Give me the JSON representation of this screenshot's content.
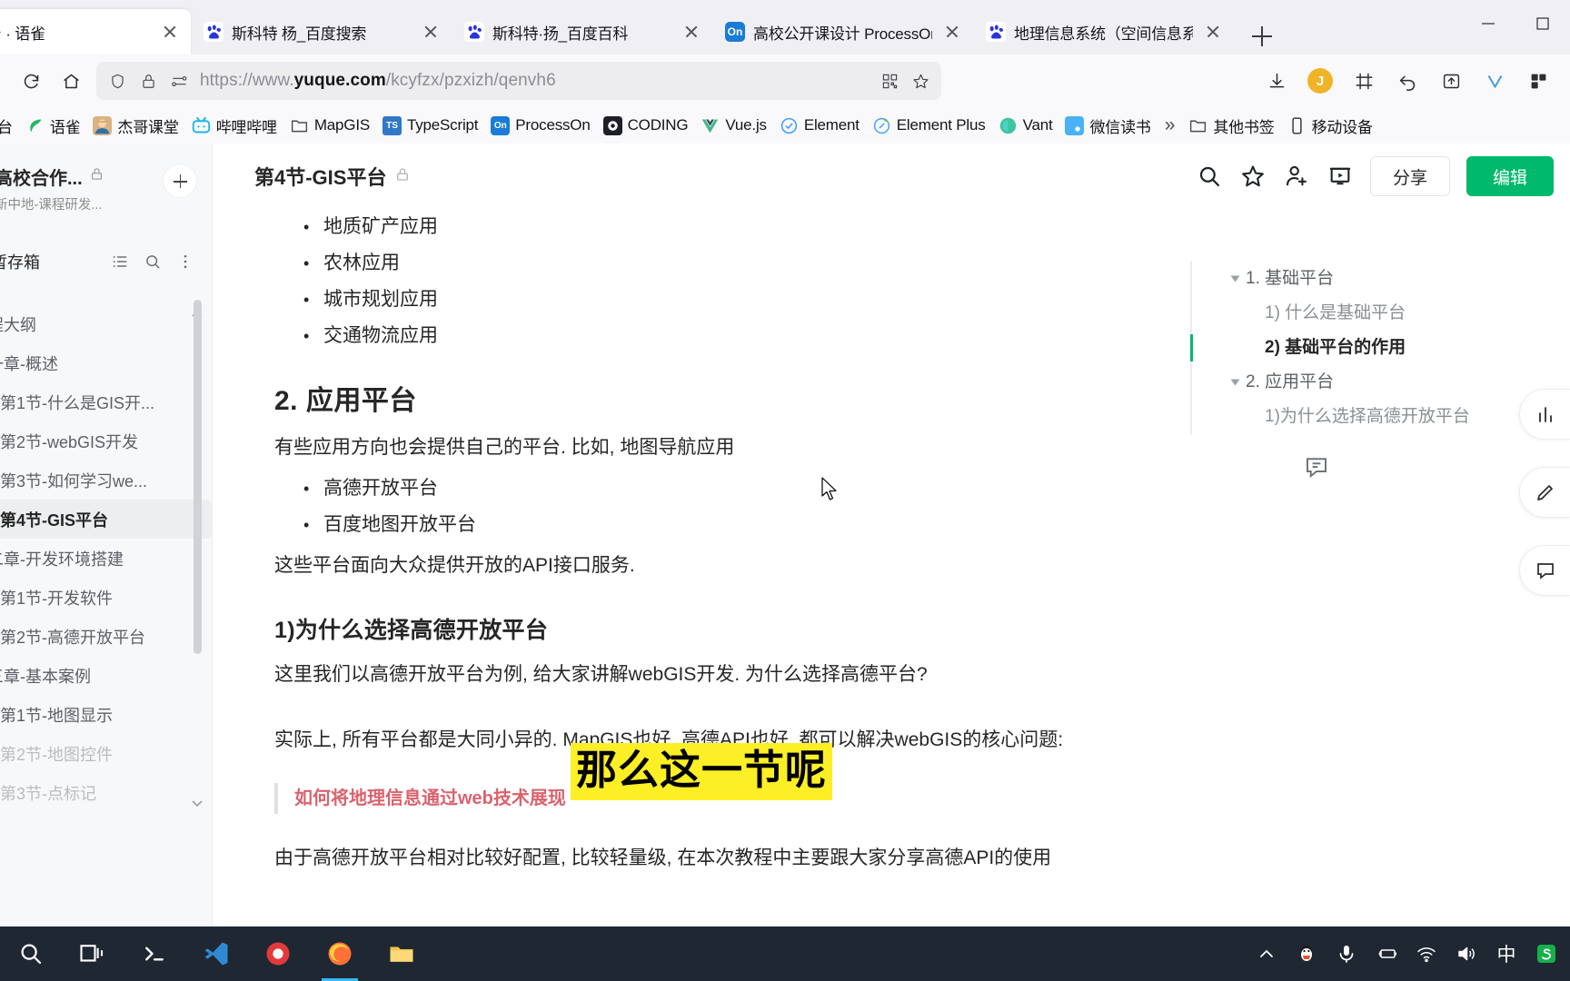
{
  "browser": {
    "tabs": [
      {
        "title": "-GIS平台 · 语雀",
        "favicon": "yuque-icon",
        "active": true
      },
      {
        "title": "斯科特 杨_百度搜索",
        "favicon": "baidu-icon",
        "active": false
      },
      {
        "title": "斯科特·扬_百度百科",
        "favicon": "baidu-icon",
        "active": false
      },
      {
        "title": "高校公开课设计 ProcessOn",
        "favicon": "processon-icon",
        "active": false
      },
      {
        "title": "地理信息系统（空间信息系统",
        "favicon": "baidu-icon",
        "active": false
      }
    ],
    "new_tab_label": "+",
    "window_controls": [
      "minimize",
      "maximize",
      "close"
    ],
    "url": {
      "prefix": "https://www.",
      "domain": "yuque.com",
      "path": "/kcyfzx/pzxizh/qenvh6"
    },
    "nav_icons": [
      "reload-icon",
      "home-icon"
    ],
    "urlbar_icons": [
      "shield-icon",
      "lock-icon",
      "permissions-icon"
    ],
    "urlbar_right_icons": [
      "qrcode-icon",
      "star-icon"
    ],
    "toolbar_right_icons": [
      "download-icon",
      "account-avatar",
      "screenshot-icon",
      "undo-icon",
      "save-page-icon",
      "vimium-icon",
      "extensions-icon"
    ],
    "account_initial": "J",
    "bookmarks": [
      {
        "label": "台",
        "icon": "partial-icon"
      },
      {
        "label": "语雀",
        "icon": "yuque-icon"
      },
      {
        "label": "杰哥课堂",
        "icon": "avatar-icon"
      },
      {
        "label": "哔哩哔哩",
        "icon": "bilibili-icon"
      },
      {
        "label": "MapGIS",
        "icon": "folder-icon"
      },
      {
        "label": "TypeScript",
        "icon": "ts-icon"
      },
      {
        "label": "ProcessOn",
        "icon": "processon-icon"
      },
      {
        "label": "CODING",
        "icon": "coding-icon"
      },
      {
        "label": "Vue.js",
        "icon": "vue-icon"
      },
      {
        "label": "Element",
        "icon": "element-icon"
      },
      {
        "label": "Element Plus",
        "icon": "element-plus-icon"
      },
      {
        "label": "Vant",
        "icon": "vant-icon"
      },
      {
        "label": "微信读书",
        "icon": "wechat-read-icon"
      }
    ],
    "bookmarks_overflow": "»",
    "other_bookmarks": "其他书签",
    "mobile_bookmarks": "移动设备"
  },
  "app": {
    "sidebar": {
      "book_title": "高校合作...",
      "book_lock_icon": "lock-icon",
      "book_subtitle": "新中地-课程研发...",
      "add_button": "+",
      "drafts_label": "暂存箱",
      "drafts_icons": [
        "list-icon",
        "search-icon",
        "more-icon"
      ],
      "items": [
        {
          "label": "程大纲",
          "level": 0,
          "state": "normal"
        },
        {
          "label": "一章-概述",
          "level": 0,
          "state": "normal"
        },
        {
          "label": "第1节-什么是GIS开...",
          "level": 1,
          "state": "normal"
        },
        {
          "label": "第2节-webGIS开发",
          "level": 1,
          "state": "normal"
        },
        {
          "label": "第3节-如何学习we...",
          "level": 1,
          "state": "normal"
        },
        {
          "label": "第4节-GIS平台",
          "level": 1,
          "state": "active"
        },
        {
          "label": "二章-开发环境搭建",
          "level": 0,
          "state": "normal"
        },
        {
          "label": "第1节-开发软件",
          "level": 1,
          "state": "normal"
        },
        {
          "label": "第2节-高德开放平台",
          "level": 1,
          "state": "normal"
        },
        {
          "label": "三章-基本案例",
          "level": 0,
          "state": "normal"
        },
        {
          "label": "第1节-地图显示",
          "level": 1,
          "state": "normal"
        },
        {
          "label": "第2节-地图控件",
          "level": 1,
          "state": "dim"
        },
        {
          "label": "第3节-点标记",
          "level": 1,
          "state": "dim"
        }
      ]
    },
    "topbar": {
      "doc_title": "第4节-GIS平台",
      "lock_icon": "lock-icon",
      "icons": [
        "search-icon",
        "star-icon",
        "add-person-icon",
        "presentation-icon"
      ],
      "share_label": "分享",
      "edit_label": "编辑"
    },
    "document": {
      "bullets_top": [
        "地质矿产应用",
        "农林应用",
        "城市规划应用",
        "交通物流应用"
      ],
      "h2": "2. 应用平台",
      "para1": "有些应用方向也会提供自己的平台. 比如, 地图导航应用",
      "bullets_mid": [
        "高德开放平台",
        "百度地图开放平台"
      ],
      "para2": "这些平台面向大众提供开放的API接口服务.",
      "h3": "1)为什么选择高德开放平台",
      "para3": "这里我们以高德开放平台为例, 给大家讲解webGIS开发. 为什么选择高德平台?",
      "para4": "实际上, 所有平台都是大同小异的. MapGIS也好, 高德API也好, 都可以解决webGIS的核心问题:",
      "quote": "如何将地理信息通过web技术展现",
      "para5": "由于高德开放平台相对比较好配置, 比较轻量级, 在本次教程中主要跟大家分享高德API的使用",
      "overlay_caption": "那么这一节呢",
      "overlay_bg_color": "#fcef25",
      "comment_icon": "comment-icon"
    },
    "toc": [
      {
        "label": "1. 基础平台",
        "level": 1,
        "active": false,
        "caret": true
      },
      {
        "label": "1) 什么是基础平台",
        "level": 2,
        "active": false,
        "caret": false
      },
      {
        "label": "2) 基础平台的作用",
        "level": 2,
        "active": true,
        "caret": false
      },
      {
        "label": "2. 应用平台",
        "level": 1,
        "active": false,
        "caret": true
      },
      {
        "label": "1)为什么选择高德开放平台",
        "level": 2,
        "active": false,
        "caret": false
      }
    ],
    "toc_active_color": "#00b96b",
    "right_rail": [
      "chart-icon",
      "pen-icon",
      "comment-icon"
    ]
  },
  "taskbar": {
    "left_items": [
      "search-icon",
      "task-view-icon",
      "terminal-icon",
      "vscode-icon",
      "camera-icon",
      "firefox-icon",
      "file-explorer-icon"
    ],
    "active_item": "firefox-icon",
    "right_items": [
      "chevron-up-icon",
      "qq-icon",
      "microphone-icon",
      "battery-icon",
      "wifi-icon",
      "volume-icon"
    ],
    "ime_label": "中",
    "tray_app": "sogou-icon"
  }
}
